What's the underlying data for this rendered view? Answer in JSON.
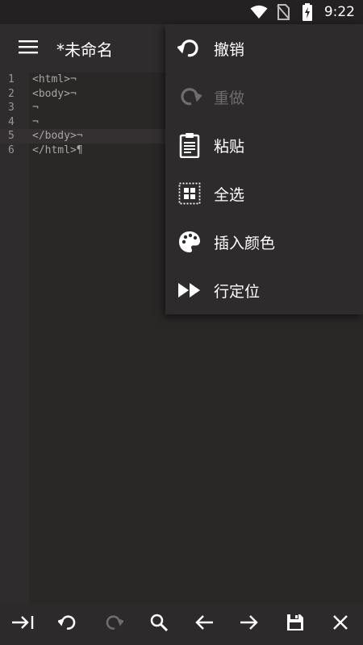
{
  "status_bar": {
    "time": "9:22",
    "icons": [
      "wifi-icon",
      "no-sim-icon",
      "battery-charging-icon"
    ]
  },
  "app_bar": {
    "title": "*未命名",
    "menu_icon": "hamburger-menu-icon"
  },
  "editor": {
    "lines": [
      {
        "number": "1",
        "code": "<html>¬"
      },
      {
        "number": "2",
        "code": "<body>¬"
      },
      {
        "number": "3",
        "code": "¬"
      },
      {
        "number": "4",
        "code": "¬"
      },
      {
        "number": "5",
        "code": "</body>¬"
      },
      {
        "number": "6",
        "code": "</html>¶"
      }
    ],
    "active_line": "5"
  },
  "popup_menu": {
    "items": [
      {
        "label": "撤销",
        "icon": "undo-icon",
        "enabled": true
      },
      {
        "label": "重做",
        "icon": "redo-icon",
        "enabled": false
      },
      {
        "label": "粘贴",
        "icon": "paste-icon",
        "enabled": true
      },
      {
        "label": "全选",
        "icon": "select-all-icon",
        "enabled": true
      },
      {
        "label": "插入颜色",
        "icon": "palette-icon",
        "enabled": true
      },
      {
        "label": "行定位",
        "icon": "fast-forward-icon",
        "enabled": true
      }
    ]
  },
  "bottom_toolbar": {
    "buttons": [
      "tab-icon",
      "undo-icon",
      "redo-icon",
      "search-icon",
      "arrow-left-icon",
      "arrow-right-icon",
      "save-icon",
      "close-icon"
    ]
  },
  "colors": {
    "background": "#2a2727",
    "app_bar": "#2f2c2d",
    "popup": "#2d2b2b",
    "text": "#ffffff",
    "disabled_text": "#6f6c6c"
  }
}
